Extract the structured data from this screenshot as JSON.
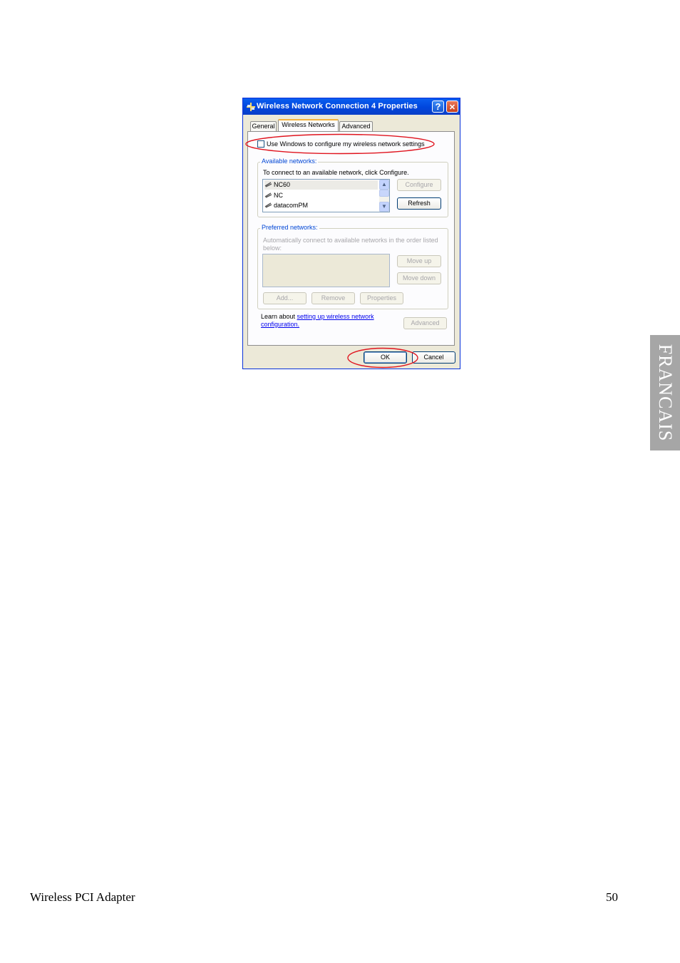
{
  "dialog": {
    "title": "Wireless Network Connection 4 Properties",
    "help_glyph": "?",
    "close_glyph": "✕",
    "title_icon": "network-connection-icon",
    "tabs": [
      {
        "label": "General"
      },
      {
        "label": "Wireless Networks"
      },
      {
        "label": "Advanced"
      }
    ],
    "active_tab": "Wireless Networks",
    "use_windows_checkbox": {
      "label": "Use Windows to configure my wireless network settings",
      "checked": false
    },
    "available": {
      "legend": "Available networks:",
      "instruction": "To connect to an available network, click Configure.",
      "networks": [
        {
          "name": "NC60",
          "selected": true
        },
        {
          "name": "NC",
          "selected": false
        },
        {
          "name": "datacomPM",
          "selected": false
        }
      ],
      "configure_label": "Configure",
      "refresh_label": "Refresh"
    },
    "preferred": {
      "legend": "Preferred networks:",
      "instruction_line1": "Automatically connect to available networks in the order listed",
      "instruction_line2": "below:",
      "move_up_label": "Move up",
      "move_down_label": "Move down",
      "add_label": "Add...",
      "remove_label": "Remove",
      "properties_label": "Properties"
    },
    "learn": {
      "prefix": "Learn about ",
      "link_line1": "setting up wireless network",
      "link_line2": "configuration."
    },
    "advanced_label": "Advanced",
    "ok_label": "OK",
    "cancel_label": "Cancel",
    "highlight_color": "#e0141e"
  },
  "sidebar": {
    "language_tab": "FRANCAIS"
  },
  "footer": {
    "product": "Wireless PCI Adapter",
    "page_number": "50"
  }
}
